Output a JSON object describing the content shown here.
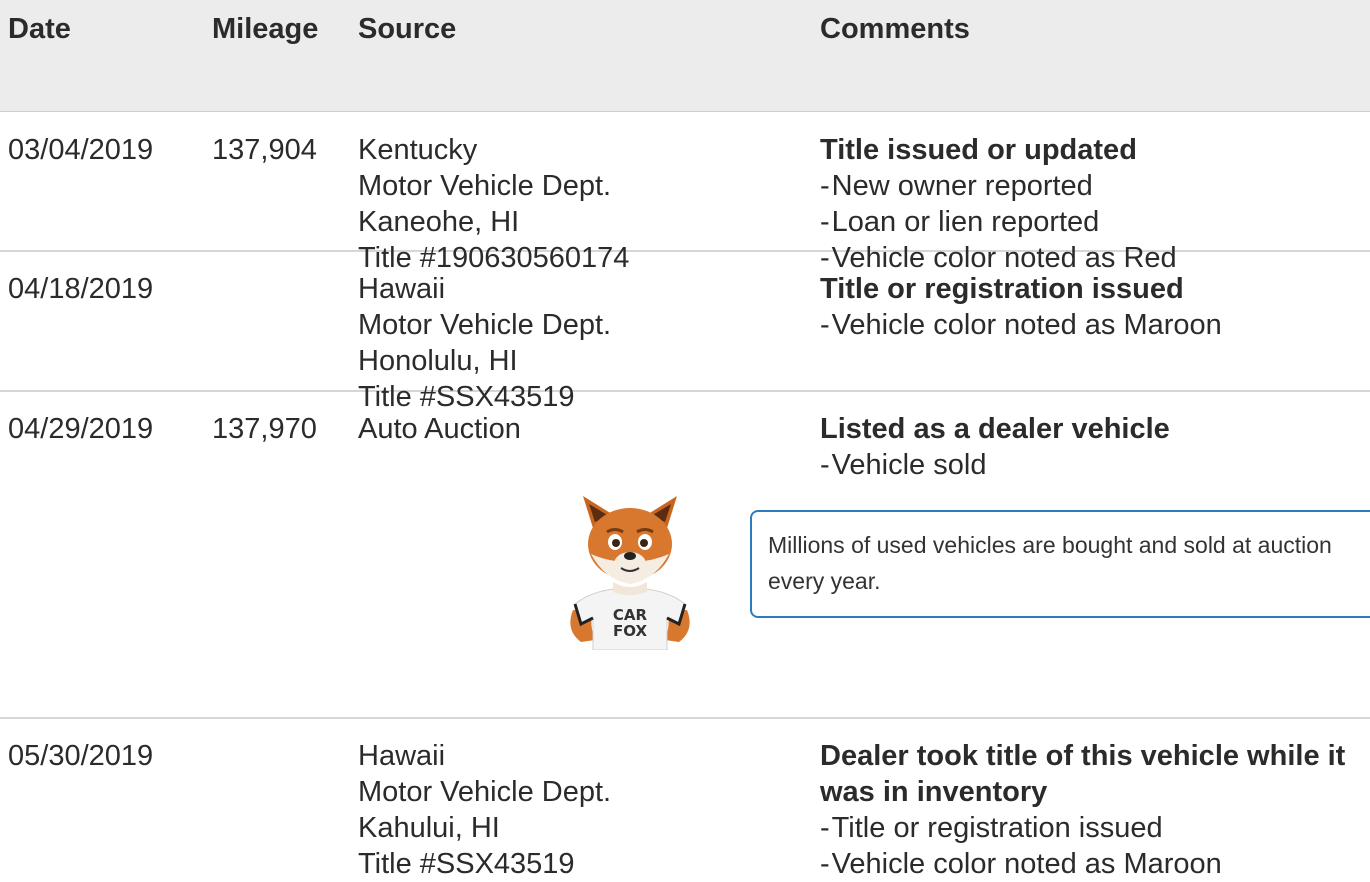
{
  "headers": {
    "date": "Date",
    "mileage": "Mileage",
    "source": "Source",
    "comments": "Comments"
  },
  "rows": [
    {
      "date": "03/04/2019",
      "mileage": "137,904",
      "source": [
        "Kentucky",
        "Motor Vehicle Dept.",
        "Kaneohe, HI",
        "Title #190630560174"
      ],
      "comment_title": "Title issued or updated",
      "comment_items": [
        "New owner reported",
        "Loan or lien reported",
        "Vehicle color noted as Red"
      ]
    },
    {
      "date": "04/18/2019",
      "mileage": "",
      "source": [
        "Hawaii",
        "Motor Vehicle Dept.",
        "Honolulu, HI",
        "Title #SSX43519"
      ],
      "comment_title": "Title or registration issued",
      "comment_items": [
        "Vehicle color noted as Maroon"
      ]
    },
    {
      "date": "04/29/2019",
      "mileage": "137,970",
      "source": [
        "Auto Auction"
      ],
      "comment_title": "Listed as a dealer vehicle",
      "comment_items": [
        "Vehicle sold"
      ],
      "callout": "Millions of used vehicles are bought and sold at auction every year.",
      "mascot_shirt": [
        "CAR",
        "FOX"
      ]
    },
    {
      "date": "05/30/2019",
      "mileage": "",
      "source": [
        "Hawaii",
        "Motor Vehicle Dept.",
        "Kahului, HI",
        "Title #SSX43519"
      ],
      "comment_title": "Dealer took title of this vehicle while it was in inventory",
      "comment_items": [
        "Title or registration issued",
        "Vehicle color noted as Maroon"
      ]
    }
  ],
  "colors": {
    "header_bg": "#ececec",
    "callout_border": "#2f7bbf",
    "divider": "#d6d6d6",
    "fox_orange": "#d8772e"
  }
}
